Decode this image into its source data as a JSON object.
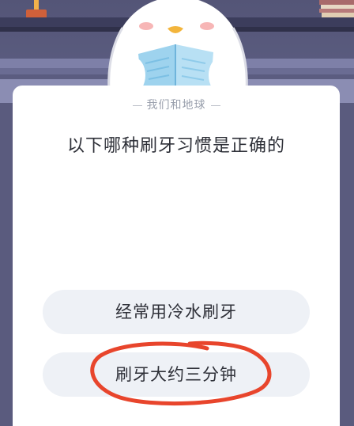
{
  "quiz": {
    "category": "我们和地球",
    "question": "以下哪种刷牙习惯是正确的",
    "options": [
      {
        "label": "经常用冷水刷牙"
      },
      {
        "label": "刷牙大约三分钟"
      }
    ]
  },
  "colors": {
    "card": "#ffffff",
    "option_bg": "#eef1f6",
    "annotation": "#e8452c",
    "background": "#5a5b7e"
  },
  "annotation": {
    "type": "hand-drawn-circle",
    "target": "option-2"
  }
}
